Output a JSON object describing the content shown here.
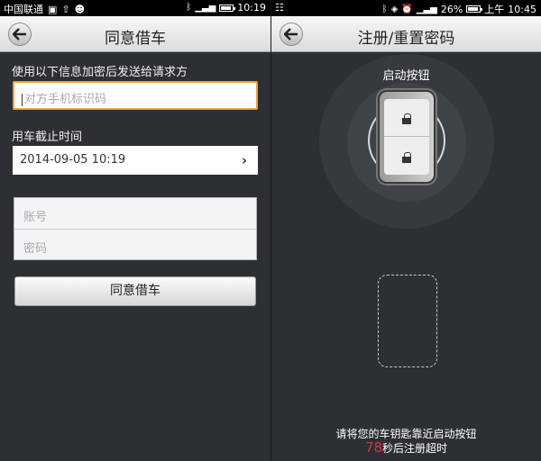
{
  "left": {
    "status": {
      "carrier": "中国联通",
      "time": "10:19"
    },
    "title": "同意借车",
    "id_label": "使用以下信息加密后发送给请求方",
    "id_placeholder": "对方手机标识码",
    "deadline_label": "用车截止时间",
    "deadline_value": "2014-09-05 10:19",
    "account_placeholder": "账号",
    "password_placeholder": "密码",
    "agree_button": "同意借车"
  },
  "right": {
    "status": {
      "battery": "26%",
      "ampm": "上午",
      "time": "10:45"
    },
    "title": "注册/重置密码",
    "start_button_label": "启动按钮",
    "hint": "请将您的车钥匙靠近启动按钮",
    "countdown": "78",
    "countdown_suffix": "秒后注册超时"
  },
  "colors": {
    "accent_orange": "#f0a030",
    "countdown_red": "#e2323c",
    "background": "#2c2f33"
  },
  "icons": [
    "back-arrow-icon",
    "chevron-right-icon",
    "lock-icon",
    "bluetooth-icon",
    "signal-icon",
    "battery-icon",
    "alarm-icon",
    "usb-icon",
    "android-icon",
    "image-icon"
  ]
}
